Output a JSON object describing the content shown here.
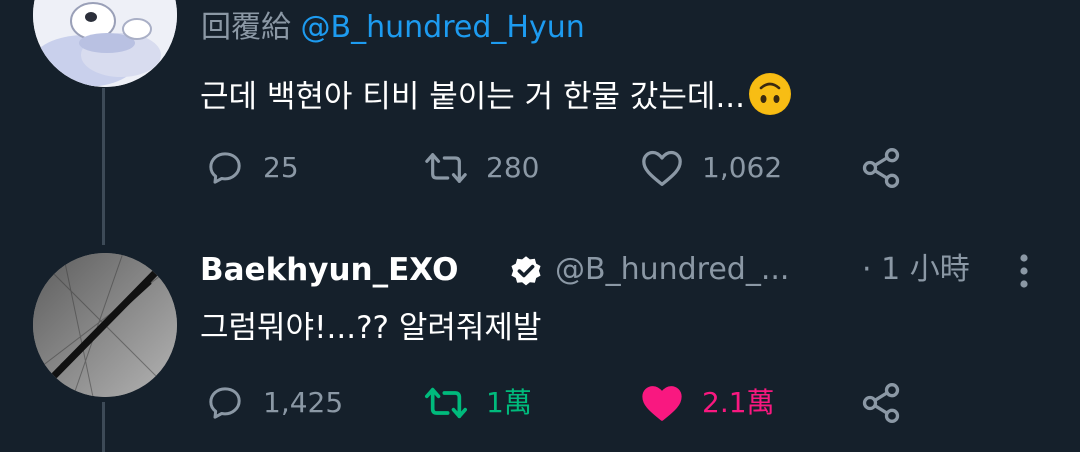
{
  "tweet1": {
    "reply_prefix": "回覆給",
    "reply_handle": "@B_hundred_Hyun",
    "text": "근데 백현아 티비 붙이는 거 한물 갔는데...",
    "emoji": "upside-down-face",
    "replies": "25",
    "retweets": "280",
    "likes": "1,062"
  },
  "tweet2": {
    "name": "Baekhyun_EXO",
    "verified": true,
    "handle": "@B_hundred_...",
    "time": "· 1 小時",
    "text": "그럼뭐야!...?? 알려줘제발",
    "replies": "1,425",
    "retweets": "1萬",
    "likes": "2.1萬"
  },
  "colors": {
    "background": "#15202b",
    "secondary_text": "#8b98a5",
    "link": "#1d9bf0",
    "retweet_active": "#00ba7c",
    "like_active": "#f91880",
    "thread_line": "#3d4a57"
  },
  "icons": [
    "reply-icon",
    "retweet-icon",
    "like-icon",
    "share-icon",
    "verified-badge-icon",
    "more-icon"
  ]
}
